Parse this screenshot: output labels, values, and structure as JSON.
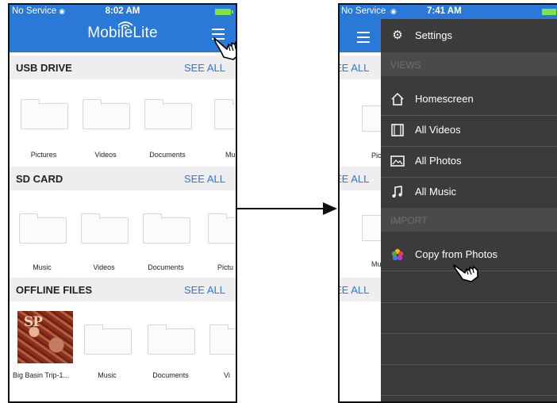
{
  "left_screen": {
    "status": {
      "carrier": "No Service",
      "time": "8:02 AM"
    },
    "app_title": "MobileLite",
    "sections": [
      {
        "title": "USB DRIVE",
        "see_all": "SEE ALL",
        "items": [
          "Pictures",
          "Videos",
          "Documents",
          "Mu"
        ]
      },
      {
        "title": "SD CARD",
        "see_all": "SEE ALL",
        "items": [
          "Music",
          "Videos",
          "Documents",
          "Pictu"
        ]
      },
      {
        "title": "OFFLINE FILES",
        "see_all": "SEE ALL",
        "items": [
          "Big Basin Trip-1...",
          "Music",
          "Documents",
          "Vi"
        ]
      }
    ],
    "photo_overlay_text": "SP"
  },
  "right_screen": {
    "status": {
      "carrier": "No Service",
      "time": "7:41 AM"
    },
    "background": {
      "see_all": "EE ALL",
      "labels": [
        "Pict",
        "Mu"
      ]
    },
    "drawer": {
      "settings_label": "Settings",
      "views_header": "VIEWS",
      "views": [
        {
          "label": "Homescreen",
          "icon": "home-icon"
        },
        {
          "label": "All Videos",
          "icon": "film-icon"
        },
        {
          "label": "All Photos",
          "icon": "photo-icon"
        },
        {
          "label": "All Music",
          "icon": "music-note-icon"
        }
      ],
      "import_header": "IMPORT",
      "import_items": [
        {
          "label": "Copy from Photos",
          "icon": "photos-flower-icon"
        }
      ]
    }
  },
  "colors": {
    "nav_blue": "#2a78d7",
    "drawer_bg": "#3b3b3b",
    "section_bg": "#eeeef1"
  }
}
